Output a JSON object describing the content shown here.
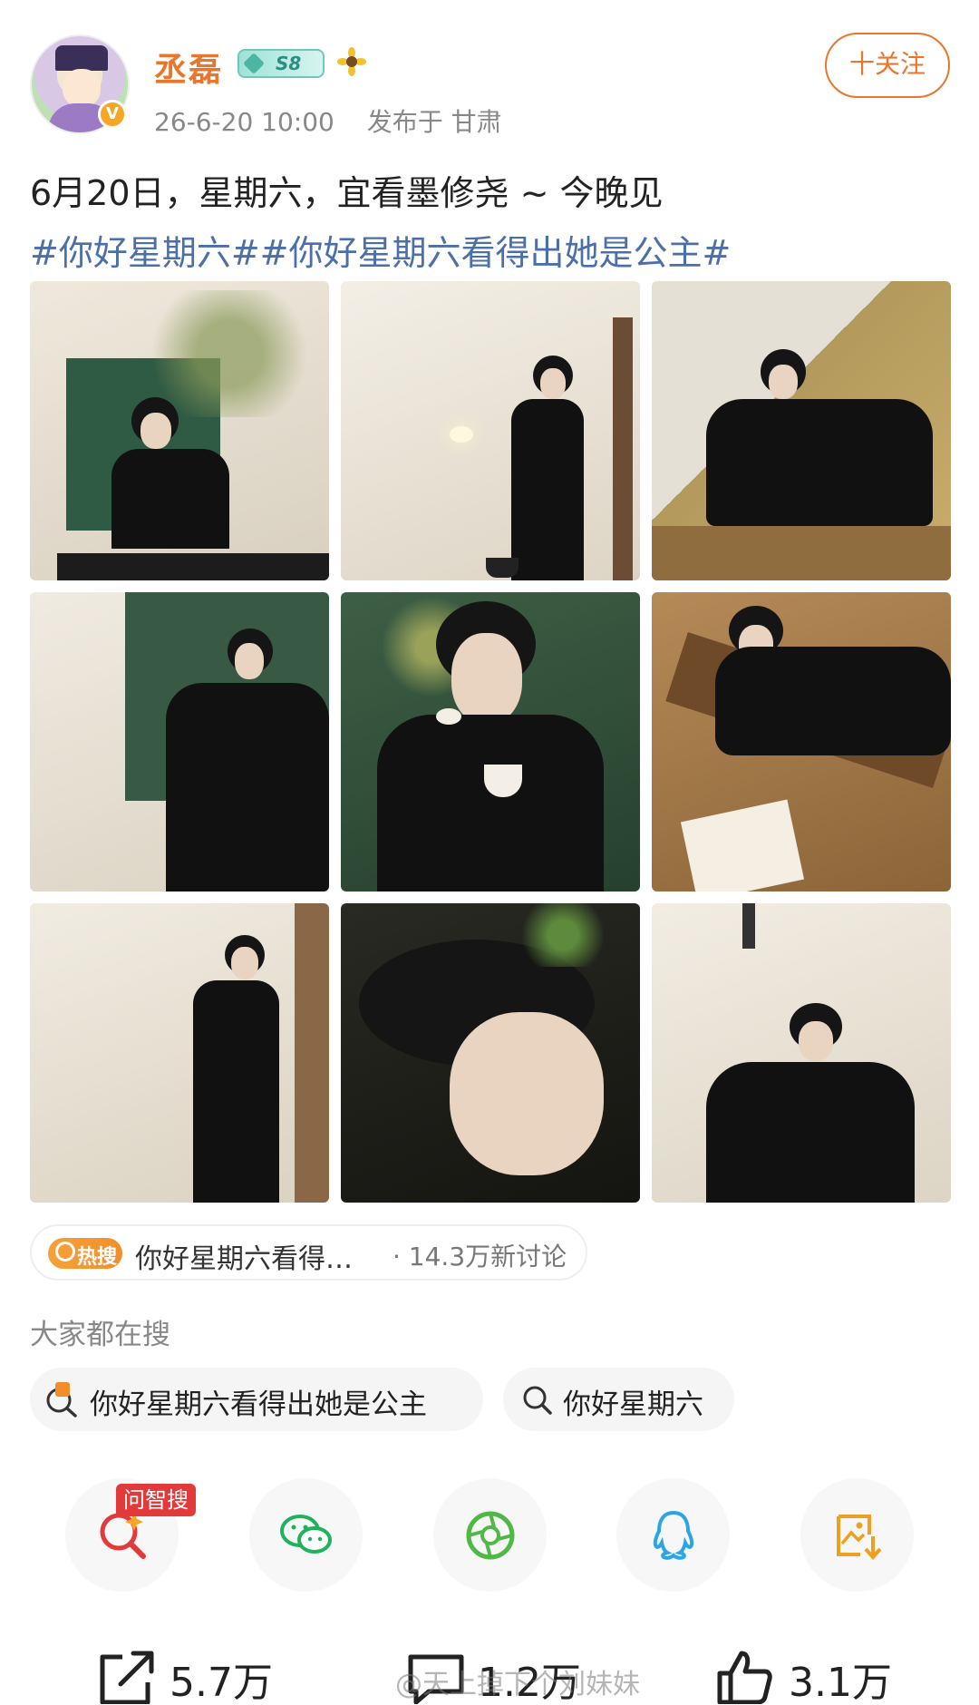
{
  "user": {
    "name": "丞磊",
    "level": "S8",
    "time": "26-6-20 10:00",
    "location": "发布于 甘肃",
    "follow_label": "十关注"
  },
  "post": {
    "text": "6月20日，星期六，宜看墨修尧 ~ 今晚见",
    "hashtags": "#你好星期六##你好星期六看得出她是公主#"
  },
  "hot": {
    "badge": "热搜",
    "topic": "你好星期六看得…",
    "count": "· 14.3万新讨论"
  },
  "search": {
    "heading": "大家都在搜",
    "items": [
      "你好星期六看得出她是公主",
      "你好星期六"
    ]
  },
  "share": {
    "wenzhisou_tag": "问智搜",
    "icons": [
      "search-ai-icon",
      "wechat-icon",
      "moments-icon",
      "qq-icon",
      "save-image-icon"
    ]
  },
  "actions": {
    "share_count": "5.7万",
    "comment_count": "1.2万",
    "like_count": "3.1万"
  },
  "watermark": "@天上掉下个刘妹妹",
  "colors": {
    "accent": "#e8762d",
    "hashtag": "#4b6fa8",
    "hot_badge": "#f6a13a"
  }
}
